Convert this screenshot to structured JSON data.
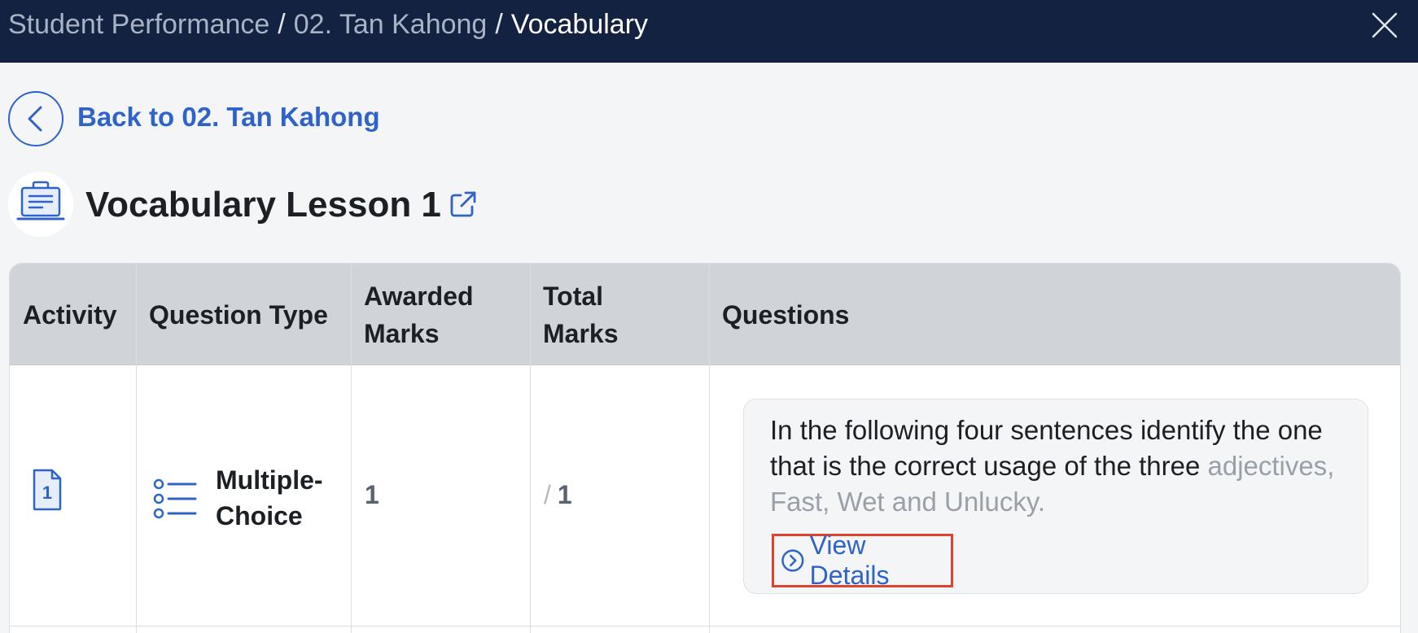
{
  "breadcrumb": {
    "items": [
      "Student Performance",
      "02. Tan Kahong",
      "Vocabulary"
    ],
    "separator": "/"
  },
  "back": {
    "label": "Back to 02. Tan Kahong"
  },
  "lesson": {
    "title": "Vocabulary Lesson 1"
  },
  "table": {
    "headers": {
      "activity": "Activity",
      "question_type": "Question Type",
      "awarded_line1": "Awarded",
      "awarded_line2": "Marks",
      "total_line1": "Total",
      "total_line2": "Marks",
      "questions": "Questions"
    },
    "rows": [
      {
        "activity_number": "1",
        "question_type_line1": "Multiple-",
        "question_type_line2": "Choice",
        "awarded_marks": "1",
        "total_separator": "/",
        "total_marks": "1",
        "question_text": "In the following four sentences identify the one that is the correct usage of the three",
        "question_text_faded": "adjectives, Fast, Wet and Unlucky.",
        "view_details_label": "View Details"
      }
    ]
  },
  "colors": {
    "topbar": "#132240",
    "accent": "#2f63c9",
    "highlight_border": "#e0432d"
  }
}
